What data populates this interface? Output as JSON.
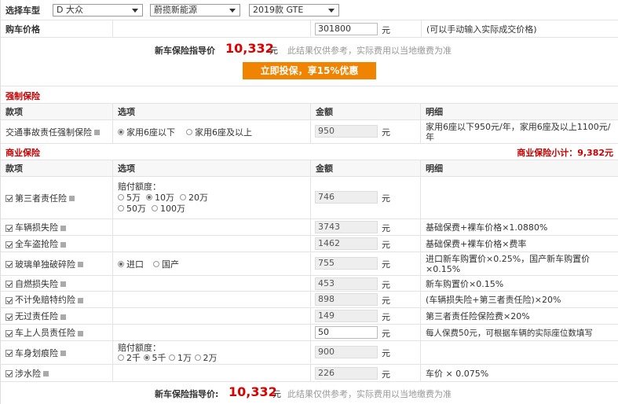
{
  "header": {
    "car_type_label": "选择车型",
    "brand": "D 大众",
    "series": "蔚揽新能源",
    "model": "2019款 GTE",
    "price_label": "购车价格",
    "price_value": "301800",
    "unit": "元",
    "price_hint": "(可以手动输入实际成交价格)"
  },
  "summary_top": {
    "label": "新车保险指导价",
    "amount": "10,332",
    "unit": "元",
    "note": "此结果仅供参考，实际费用以当地缴费为准",
    "button": "立即投保，享15%优惠"
  },
  "compulsory": {
    "title": "强制保险",
    "cols": [
      "款项",
      "选项",
      "金额",
      "明细"
    ],
    "item": {
      "name": "交通事故责任强制保险",
      "opt1": "家用6座以下",
      "opt2": "家用6座及以上",
      "amount": "950",
      "unit": "元",
      "detail": "家用6座以下950元/年，家用6座及以上1100元/年"
    }
  },
  "commercial": {
    "title": "商业保险",
    "subtotal": "商业保险小计：9,382元",
    "cols": [
      "款项",
      "选项",
      "金额",
      "明细"
    ],
    "items": [
      {
        "name": "第三者责任险",
        "amount": "746",
        "unit": "元",
        "detail": ""
      },
      {
        "name": "车辆损失险",
        "amount": "3743",
        "unit": "元",
        "detail": "基础保费+裸车价格×1.0880%"
      },
      {
        "name": "全车盗抢险",
        "amount": "1462",
        "unit": "元",
        "detail": "基础保费+裸车价格×费率"
      },
      {
        "name": "玻璃单独破碎险",
        "amount": "755",
        "unit": "元",
        "detail": "进口新车购置价×0.25%，国产新车购置价×0.15%"
      },
      {
        "name": "自燃损失险",
        "amount": "453",
        "unit": "元",
        "detail": "新车购置价×0.15%"
      },
      {
        "name": "不计免赔特约险",
        "amount": "898",
        "unit": "元",
        "detail": "(车辆损失险+第三者责任险)×20%"
      },
      {
        "name": "无过责任险",
        "amount": "149",
        "unit": "元",
        "detail": "第三者责任险保险费×20%"
      },
      {
        "name": "车上人员责任险",
        "amount": "50",
        "unit": "元",
        "detail": "每人保费50元，可根据车辆的实际座位数填写"
      },
      {
        "name": "车身划痕险",
        "amount": "900",
        "unit": "元",
        "detail": ""
      },
      {
        "name": "涉水险",
        "amount": "226",
        "unit": "元",
        "detail": "车价 × 0.075%"
      }
    ],
    "third_party_opts": {
      "label": "赔付额度：",
      "o1": "5万",
      "o2": "10万",
      "o3": "20万",
      "o4": "50万",
      "o5": "100万"
    },
    "glass_opts": {
      "o1": "进口",
      "o2": "国产"
    },
    "scratch_opts": {
      "label": "赔付额度：",
      "o1": "2千",
      "o2": "5千",
      "o3": "1万",
      "o4": "2万"
    }
  },
  "summary_bottom": {
    "label": "新车保险指导价:",
    "amount": "10,332",
    "unit": "元",
    "note": "此结果仅供参考，实际费用以当地缴费为准"
  }
}
